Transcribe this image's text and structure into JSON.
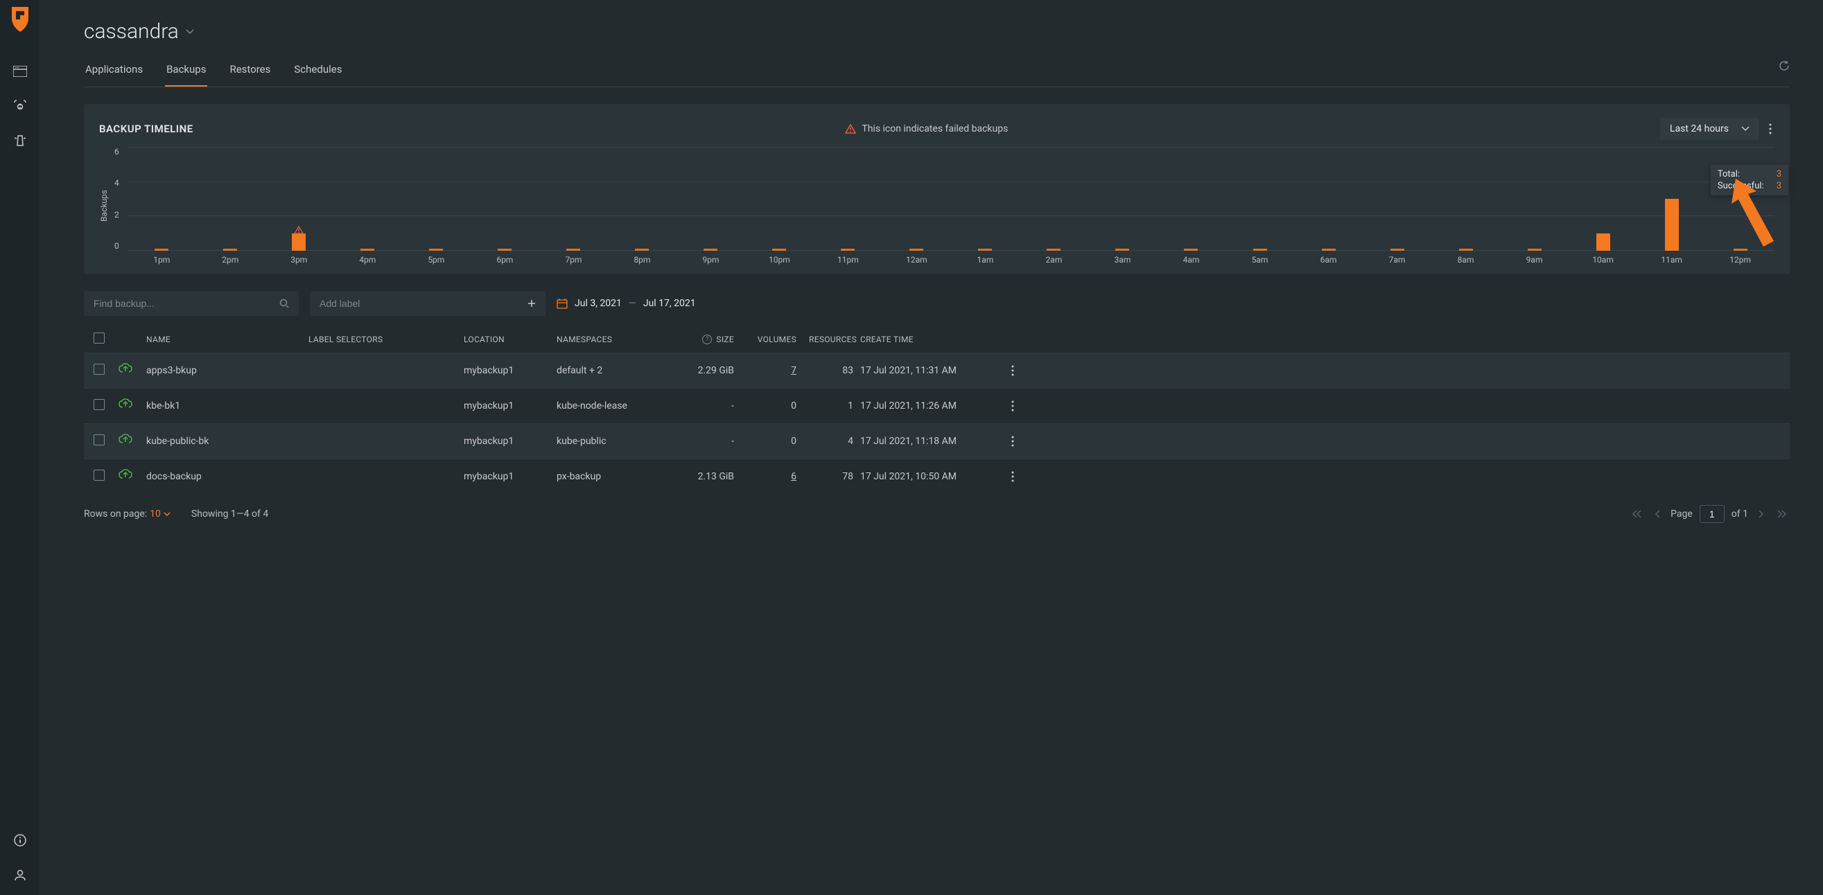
{
  "header": {
    "title": "cassandra"
  },
  "tabs": {
    "items": [
      {
        "label": "Applications"
      },
      {
        "label": "Backups"
      },
      {
        "label": "Restores"
      },
      {
        "label": "Schedules"
      }
    ],
    "active_index": 1
  },
  "timeline_panel": {
    "title": "BACKUP TIMELINE",
    "failed_note": "This icon indicates failed backups",
    "range_label": "Last 24 hours",
    "y_axis_label": "Backups"
  },
  "tooltip": {
    "total_label": "Total:",
    "total_value": "3",
    "success_label": "Successful:",
    "success_value": "3"
  },
  "filters": {
    "find_placeholder": "Find backup...",
    "add_label_placeholder": "Add label",
    "date_start": "Jul 3, 2021",
    "date_end": "Jul 17, 2021"
  },
  "table": {
    "headers": {
      "name": "NAME",
      "labels": "LABEL SELECTORS",
      "location": "LOCATION",
      "namespaces": "NAMESPACES",
      "size": "SIZE",
      "volumes": "VOLUMES",
      "resources": "RESOURCES",
      "create_time": "CREATE TIME"
    },
    "rows": [
      {
        "name": "apps3-bkup",
        "location": "mybackup1",
        "namespaces": "default + 2",
        "size": "2.29 GiB",
        "volumes": "7",
        "resources": "83",
        "time": "17 Jul 2021, 11:31 AM",
        "vol_link": true
      },
      {
        "name": "kbe-bk1",
        "location": "mybackup1",
        "namespaces": "kube-node-lease",
        "size": "-",
        "volumes": "0",
        "resources": "1",
        "time": "17 Jul 2021, 11:26 AM",
        "vol_link": false
      },
      {
        "name": "kube-public-bk",
        "location": "mybackup1",
        "namespaces": "kube-public",
        "size": "-",
        "volumes": "0",
        "resources": "4",
        "time": "17 Jul 2021, 11:18 AM",
        "vol_link": false
      },
      {
        "name": "docs-backup",
        "location": "mybackup1",
        "namespaces": "px-backup",
        "size": "2.13 GiB",
        "volumes": "6",
        "resources": "78",
        "time": "17 Jul 2021, 10:50 AM",
        "vol_link": true
      }
    ]
  },
  "footer": {
    "rows_label": "Rows on page: ",
    "rows_value": "10",
    "showing": "Showing 1—4 of 4",
    "page_label": "Page",
    "page_value": "1",
    "of_label": "of 1"
  },
  "chart_data": {
    "type": "bar",
    "title": "BACKUP TIMELINE",
    "ylabel": "Backups",
    "ylim": [
      0,
      6
    ],
    "y_ticks": [
      0,
      2,
      4,
      6
    ],
    "categories": [
      "1pm",
      "2pm",
      "3pm",
      "4pm",
      "5pm",
      "6pm",
      "7pm",
      "8pm",
      "9pm",
      "10pm",
      "11pm",
      "12am",
      "1am",
      "2am",
      "3am",
      "4am",
      "5am",
      "6am",
      "7am",
      "8am",
      "9am",
      "10am",
      "11am",
      "12pm"
    ],
    "values": [
      0,
      0,
      1,
      0,
      0,
      0,
      0,
      0,
      0,
      0,
      0,
      0,
      0,
      0,
      0,
      0,
      0,
      0,
      0,
      0,
      0,
      1,
      3,
      0
    ],
    "failed_flags": [
      false,
      false,
      true,
      false,
      false,
      false,
      false,
      false,
      false,
      false,
      false,
      false,
      false,
      false,
      false,
      false,
      false,
      false,
      false,
      false,
      false,
      false,
      false,
      false
    ]
  }
}
